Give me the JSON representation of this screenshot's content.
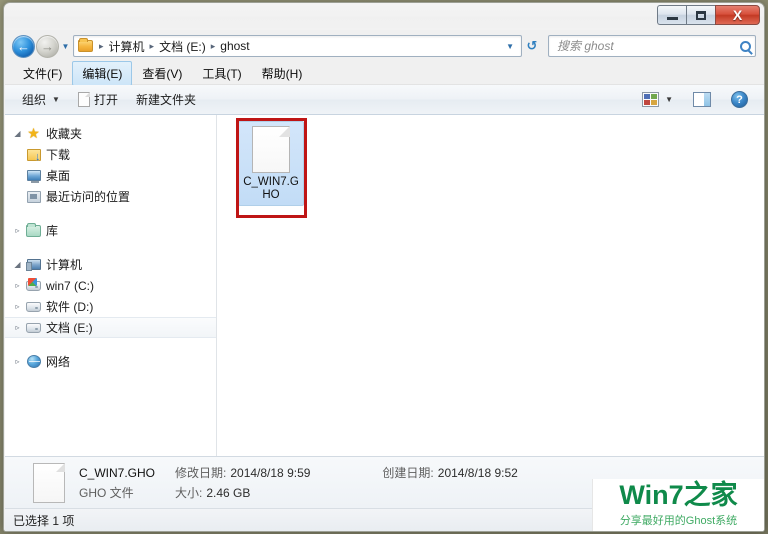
{
  "window": {
    "controls": {
      "minimize": "–",
      "maximize": "□",
      "close": "X"
    }
  },
  "address_bar": {
    "back_icon": "back-arrow-icon",
    "forward_icon": "forward-arrow-icon",
    "history_caret": "▼",
    "folder_icon": "folder-icon",
    "breadcrumbs": [
      "计算机",
      "文档 (E:)",
      "ghost"
    ],
    "separator": "▸",
    "dropdown_caret": "▼",
    "refresh_icon": "↺"
  },
  "search": {
    "placeholder": "搜索 ghost",
    "value": "",
    "icon": "search-icon"
  },
  "menu": {
    "items": [
      {
        "label": "文件(F)",
        "active": false
      },
      {
        "label": "编辑(E)",
        "active": true
      },
      {
        "label": "查看(V)",
        "active": false
      },
      {
        "label": "工具(T)",
        "active": false
      },
      {
        "label": "帮助(H)",
        "active": false
      }
    ]
  },
  "toolbar": {
    "organize": "组织",
    "organize_caret": "▼",
    "open": "打开",
    "new_folder": "新建文件夹",
    "view_icon": "view-options-icon",
    "view_caret": "▼",
    "preview_pane_icon": "preview-pane-icon",
    "help_icon": "?"
  },
  "sidebar": {
    "groups": [
      {
        "label": "收藏夹",
        "icon": "star-icon",
        "expander": "◢",
        "items": [
          {
            "label": "下载",
            "icon": "downloads-icon"
          },
          {
            "label": "桌面",
            "icon": "desktop-icon"
          },
          {
            "label": "最近访问的位置",
            "icon": "recent-places-icon"
          }
        ]
      },
      {
        "label": "库",
        "icon": "library-icon",
        "expander": "▹",
        "items": []
      },
      {
        "label": "计算机",
        "icon": "computer-icon",
        "expander": "◢",
        "items": [
          {
            "label": "win7 (C:)",
            "icon": "windows-drive-icon",
            "expander": "▹",
            "selected": false
          },
          {
            "label": "软件 (D:)",
            "icon": "drive-icon",
            "expander": "▹",
            "selected": false
          },
          {
            "label": "文档 (E:)",
            "icon": "drive-icon",
            "expander": "▹",
            "selected": true
          }
        ]
      },
      {
        "label": "网络",
        "icon": "network-icon",
        "expander": "▹",
        "items": []
      }
    ]
  },
  "files": [
    {
      "name": "C_WIN7.GHO",
      "icon": "gho-file-icon",
      "selected": true
    }
  ],
  "annotation": {
    "color": "#bf1515",
    "shape": "rectangle"
  },
  "details_pane": {
    "icon": "gho-file-icon",
    "name": "C_WIN7.GHO",
    "type": "GHO 文件",
    "modified_label": "修改日期:",
    "modified_value": "2014/8/18 9:59",
    "created_label": "创建日期:",
    "created_value": "2014/8/18 9:52",
    "size_label": "大小:",
    "size_value": "2.46 GB"
  },
  "status_bar": {
    "text": "已选择 1 项"
  },
  "watermark": {
    "title": "Win7之家",
    "subtitle": "分享最好用的Ghost系统",
    "color": "#0f8a4a"
  }
}
